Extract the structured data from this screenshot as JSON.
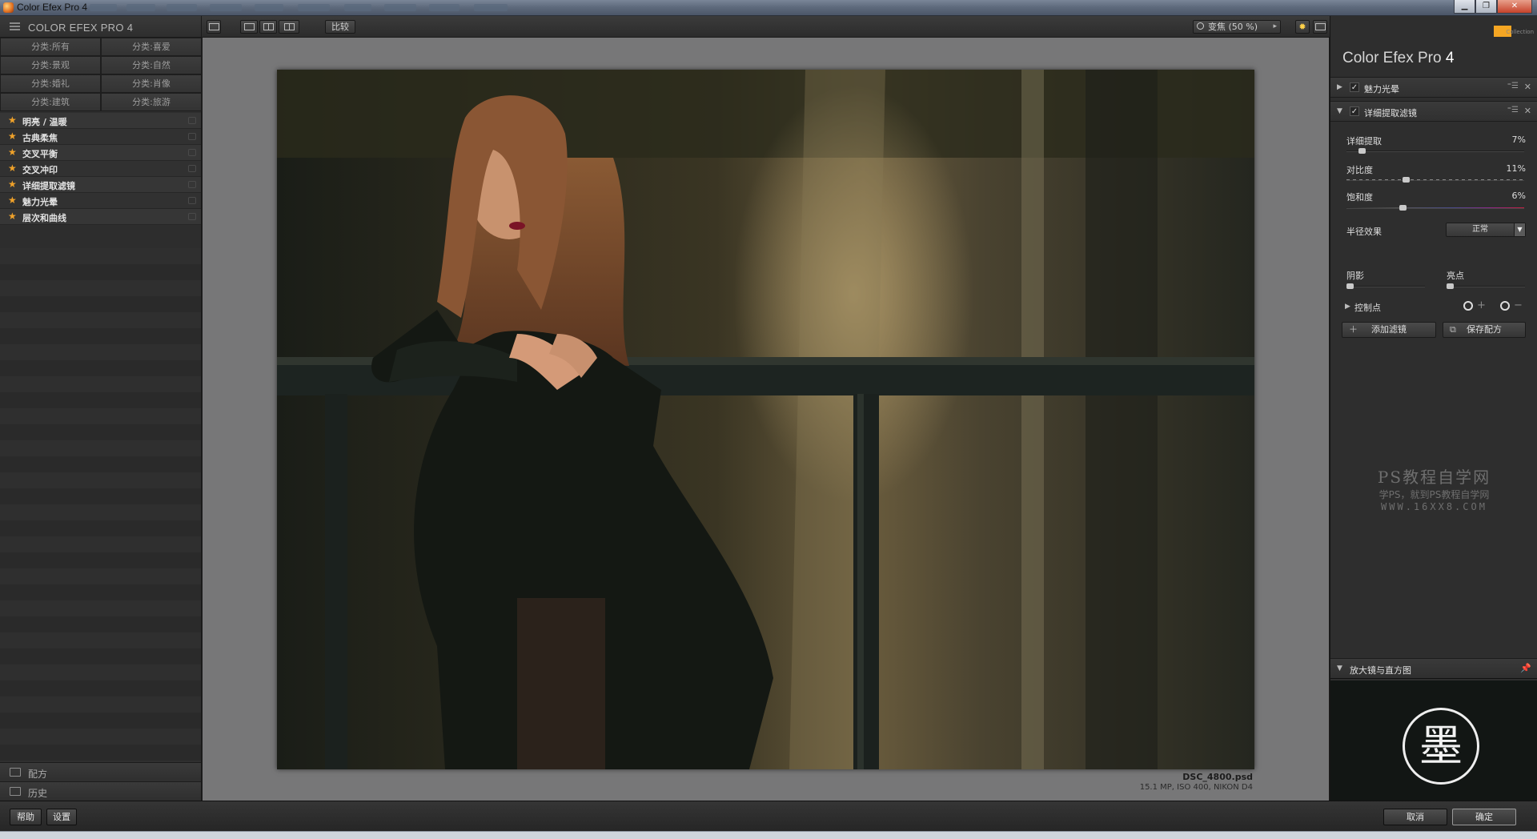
{
  "window": {
    "title": "Color Efex Pro 4"
  },
  "left_panel": {
    "brand": "COLOR EFEX PRO 4",
    "categories": [
      "分类:所有",
      "分类:喜爱",
      "分类:景观",
      "分类:自然",
      "分类:婚礼",
      "分类:肖像",
      "分类:建筑",
      "分类:旅游"
    ],
    "filters": [
      "明亮 / 温暖",
      "古典柔焦",
      "交叉平衡",
      "交叉冲印",
      "详细提取滤镜",
      "魅力光晕",
      "层次和曲线"
    ],
    "footer": {
      "recipes": "配方",
      "history": "历史"
    }
  },
  "toolbar": {
    "compare": "比较",
    "zoom": "变焦 (50 %)"
  },
  "image": {
    "filename": "DSC_4800.psd",
    "info": "15.1 MP, ISO 400, NIKON D4"
  },
  "right_panel": {
    "logo_text": "Collection",
    "title_main": "Color Efex Pro",
    "title_version": "4",
    "filter1": {
      "label": "魅力光晕",
      "check": "✓"
    },
    "filter2": {
      "label": "详细提取滤镜",
      "check": "✓",
      "detail_label": "详细提取",
      "detail_value": "7%",
      "detail_level": 0.07,
      "contrast_label": "对比度",
      "contrast_value": "11%",
      "contrast_level": 0.33,
      "saturation_label": "饱和度",
      "saturation_value": "6%",
      "saturation_level": 0.31,
      "radius_label": "半径效果",
      "radius_value": "正常",
      "shadows_label": "阴影",
      "highlights_label": "亮点",
      "control_points_label": "控制点"
    },
    "add_filter": "添加滤镜",
    "save_recipe": "保存配方",
    "watermark": {
      "line1": "PS教程自学网",
      "line2": "学PS，就到PS教程自学网",
      "line3": "WWW.16XX8.COM"
    },
    "loupe_label": "放大镜与直方图",
    "seal_char": "墨"
  },
  "bottom": {
    "help": "帮助",
    "settings": "设置",
    "cancel": "取消",
    "ok": "确定"
  }
}
